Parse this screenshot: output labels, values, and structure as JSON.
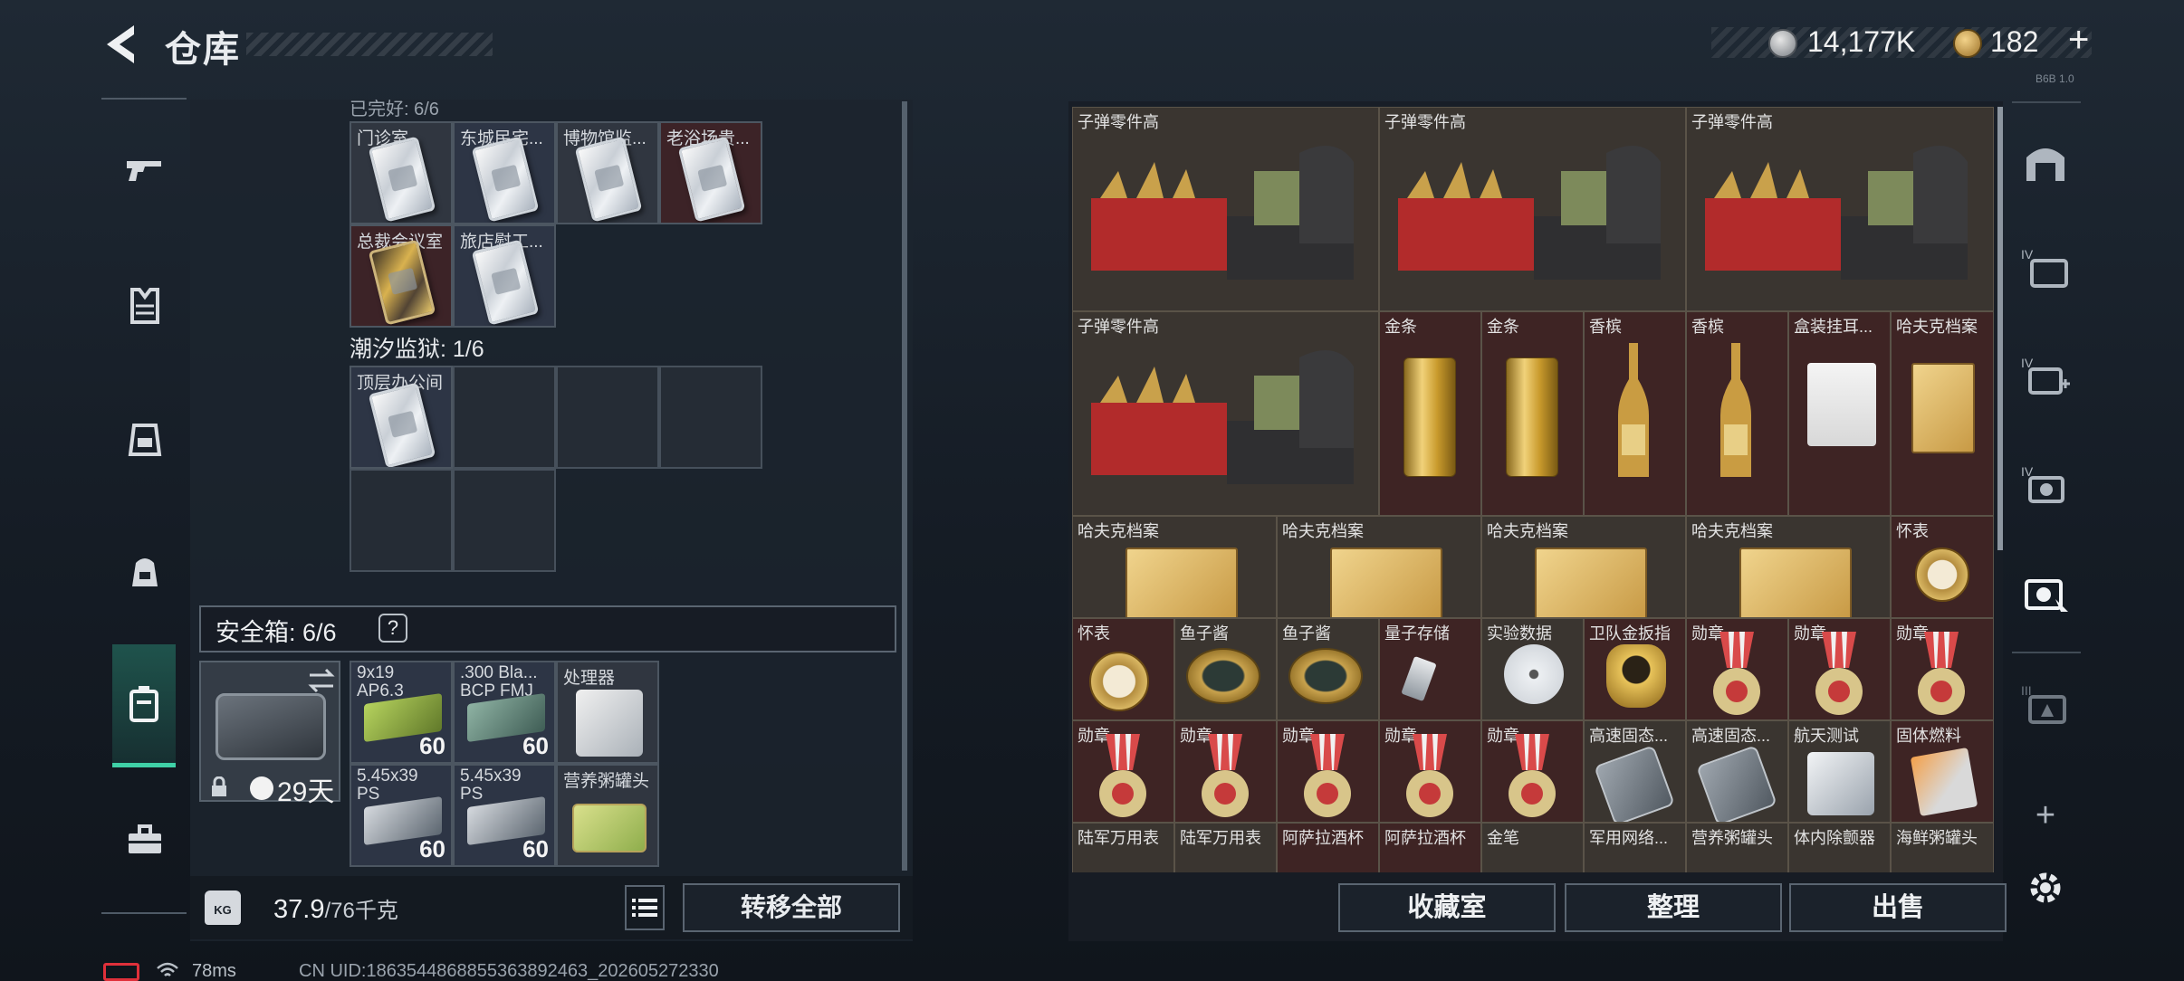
{
  "header": {
    "title": "仓库",
    "currency_value": "14,177K",
    "premium_value": "182",
    "premium_plus": "+",
    "small_text": "B6B 1.0"
  },
  "sidebar": {
    "items": [
      {
        "name": "sidebar-item-weapons",
        "icon": "gun-icon"
      },
      {
        "name": "sidebar-item-armor",
        "icon": "vest-icon"
      },
      {
        "name": "sidebar-item-helmet",
        "icon": "helmet-icon"
      },
      {
        "name": "sidebar-item-backpack",
        "icon": "backpack-icon"
      },
      {
        "name": "sidebar-item-container",
        "icon": "container-icon",
        "active": true
      },
      {
        "name": "sidebar-item-toolbox",
        "icon": "toolbox-icon"
      }
    ]
  },
  "left": {
    "hidden_row_label": "已完好: 6/6",
    "keys_row1": [
      "门诊室",
      "东城民宅...",
      "博物馆监...",
      "老浴场贵..."
    ],
    "keys_row2": [
      "总裁会议室",
      "旅店慰工..."
    ],
    "prison_label": "潮汐监狱: 1/6",
    "prison_keys": [
      "顶层办公间"
    ],
    "safe_label": "安全箱: 6/6",
    "safe_help": "?",
    "safe_days": "29天",
    "safe_items": [
      {
        "label": "9x19\nAP6.3",
        "qty": "60"
      },
      {
        "label": ".300 Bla...\nBCP FMJ",
        "qty": "60"
      },
      {
        "label": "处理器",
        "qty": ""
      },
      {
        "label": "5.45x39\nPS",
        "qty": "60"
      },
      {
        "label": "5.45x39\nPS",
        "qty": "60"
      },
      {
        "label": "营养粥罐头",
        "qty": ""
      }
    ],
    "weight_current": "37.9",
    "weight_max": "/76千克",
    "kg_label": "KG",
    "transfer_label": "转移全部"
  },
  "right": {
    "row1": [
      "子弹零件高",
      "子弹零件高",
      "子弹零件高"
    ],
    "row2": [
      "子弹零件高",
      "金条",
      "金条",
      "香槟",
      "香槟",
      "盒装挂耳...",
      "哈夫克档案"
    ],
    "row3": [
      "哈夫克档案",
      "哈夫克档案",
      "哈夫克档案",
      "哈夫克档案",
      "怀表"
    ],
    "row4": [
      "怀表",
      "鱼子酱",
      "鱼子酱",
      "量子存储",
      "实验数据",
      "卫队金扳指",
      "勋章",
      "勋章",
      "勋章"
    ],
    "row5": [
      "勋章",
      "勋章",
      "勋章",
      "勋章",
      "勋章",
      "高速固态...",
      "高速固态...",
      "航天测试",
      "固体燃料"
    ],
    "row6": [
      "陆军万用表",
      "陆军万用表",
      "阿萨拉酒杯",
      "阿萨拉酒杯",
      "金笔",
      "军用网络...",
      "营养粥罐头",
      "体内除颤器",
      "海鲜粥罐头"
    ],
    "btn_collection": "收藏室",
    "btn_sort": "整理",
    "btn_sell": "出售"
  },
  "right_tools": {
    "plus": "+",
    "icons": [
      "home-icon",
      "case-iv-icon",
      "medkit-iv-icon",
      "camera-iv-icon",
      "camera-select-icon",
      "case-iii-icon",
      "add-icon",
      "gear-icon"
    ]
  },
  "footer": {
    "ping": "78ms",
    "uid": "CN UID:1863544868855363892463_202605272330"
  },
  "colors": {
    "accent": "#3fd1a7",
    "red_cell": "#3e2424",
    "blue_cell": "#2d3545",
    "gold": "#d9b24f"
  }
}
